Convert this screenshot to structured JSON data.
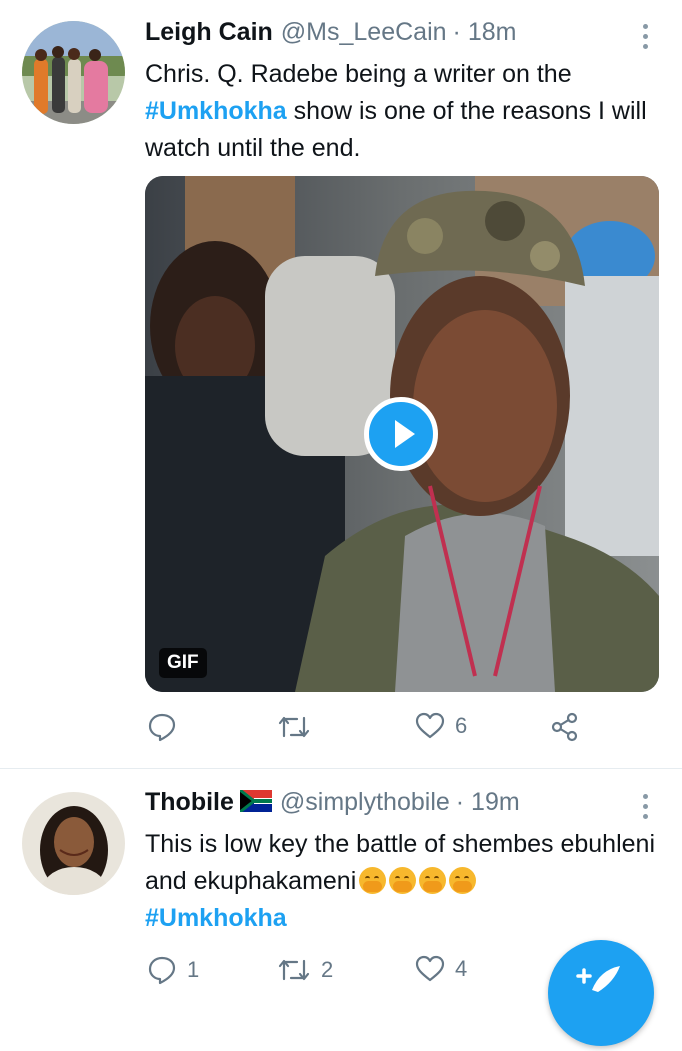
{
  "tweets": [
    {
      "name": "Leigh Cain",
      "handle": "@Ms_LeeCain",
      "time": "· 18m",
      "text_part1": "Chris. Q. Radebe being a writer on the",
      "hashtag": "#Umkhokha",
      "text_part2": " show is one of the reasons I will watch until the end.",
      "media_badge": "GIF",
      "replies": "",
      "retweets": "",
      "likes": "6"
    },
    {
      "name": "Thobile",
      "handle": "@simplythobile",
      "time": "· 19m",
      "text_part1": "This is low key the battle of shembes ebuhleni and ekuphakameni",
      "hashtag": "#Umkhokha",
      "replies": "1",
      "retweets": "2",
      "likes": "4"
    }
  ],
  "icons": {
    "reply": "reply-icon",
    "retweet": "retweet-icon",
    "like": "heart-icon",
    "share": "share-icon",
    "more": "more-vertical-icon",
    "play": "play-icon",
    "compose": "compose-tweet-icon",
    "flag": "south-africa-flag-icon",
    "emoji": "face-with-hand-over-mouth-icon"
  },
  "colors": {
    "accent": "#1da1f2",
    "secondary_text": "#657786",
    "divider": "#e6ecf0"
  }
}
